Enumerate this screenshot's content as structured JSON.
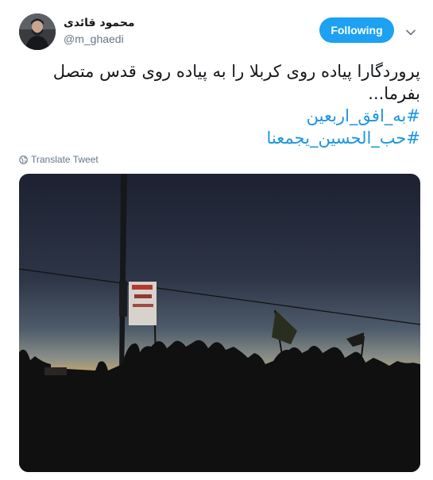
{
  "author": {
    "display_name": "محمود قائدی",
    "handle": "@m_ghaedi",
    "avatar_icon": "user-avatar"
  },
  "actions": {
    "follow_label": "Following",
    "follow_color": "#1da1f2",
    "caret_icon": "chevron-down-icon"
  },
  "tweet": {
    "text_line1": "پروردگارا پیاده روی کربلا را به پیاده روی قدس متصل",
    "text_line2": "بفرما...",
    "hashtags": [
      "#به_افق_اربعین",
      "#حب_الحسین_یجمعنا"
    ],
    "hashtag_color": "#1b95e0",
    "translate_label": "Translate Tweet",
    "translate_icon": "globe-icon"
  },
  "media": {
    "description_icon": "photo-dusk-pilgrims"
  }
}
